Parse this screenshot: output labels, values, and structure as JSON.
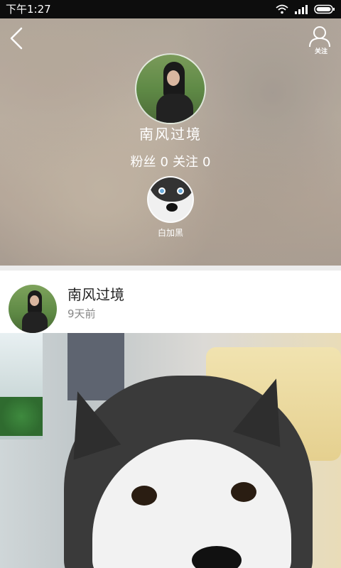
{
  "status_bar": {
    "time": "下午1:27",
    "icons": [
      "wifi-icon",
      "signal-icon",
      "battery-icon"
    ]
  },
  "header": {
    "back_icon": "back-chevron-icon",
    "follow_icon": "person-icon",
    "follow_label": "关注"
  },
  "profile": {
    "name": "南风过境",
    "fans_label": "粉丝",
    "fans_count": "0",
    "following_label": "关注",
    "following_count": "0",
    "pet_name": "白加黑"
  },
  "post": {
    "author": "南风过境",
    "time_ago": "9天前"
  },
  "colors": {
    "status_bar_bg": "#0d0d0d",
    "divider": "#ececec",
    "author_text": "#222222",
    "time_text": "#888888"
  }
}
